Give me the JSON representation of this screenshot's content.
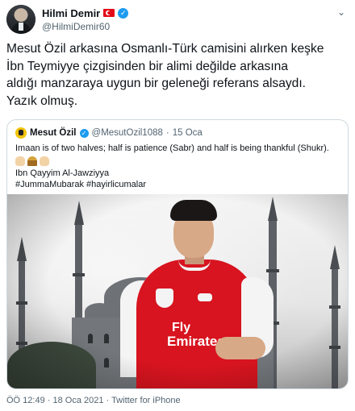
{
  "tweet": {
    "author": {
      "display_name": "Hilmi Demir",
      "handle": "@HilmiDemir60",
      "flag_icon": "turkey-flag-icon",
      "verified_icon": "verified-badge-icon"
    },
    "more_icon": "chevron-down-icon",
    "text": "Mesut Özil arkasına Osmanlı-Türk camisini alırken keşke\nİbn Teymiyye çizgisinden bir alimi değilde arkasına\naldığı manzaraya uygun bir geleneği referans alsaydı.\nYazık olmuş.",
    "meta": {
      "time": "ÖÖ 12:49",
      "sep1": " · ",
      "date": "18 Oca 2021",
      "sep2": " · ",
      "source": "Twitter for iPhone"
    }
  },
  "quoted_tweet": {
    "display_name": "Mesut Özil",
    "handle": "@MesutOzil1088",
    "dot": "·",
    "date": "15 Oca",
    "lines": [
      "Imaan is of two halves;  half is patience (Sabr) and half is being thankful (Shukr).",
      "Ibn Qayyim Al-Jawziyya",
      "#JummaMubarak #hayirlicumalar"
    ],
    "emoji_icons": [
      "palms-up-icon",
      "mosque-icon",
      "palms-up-icon"
    ],
    "image": {
      "description_icon": "illustrated-photo-icon",
      "jersey_text": [
        "Fly",
        "Emirates"
      ]
    }
  },
  "colors": {
    "text_primary": "#0f1419",
    "text_secondary": "#536471",
    "verified": "#1d9bf0",
    "border": "#cfd9de",
    "jersey_red": "#d7141f"
  }
}
